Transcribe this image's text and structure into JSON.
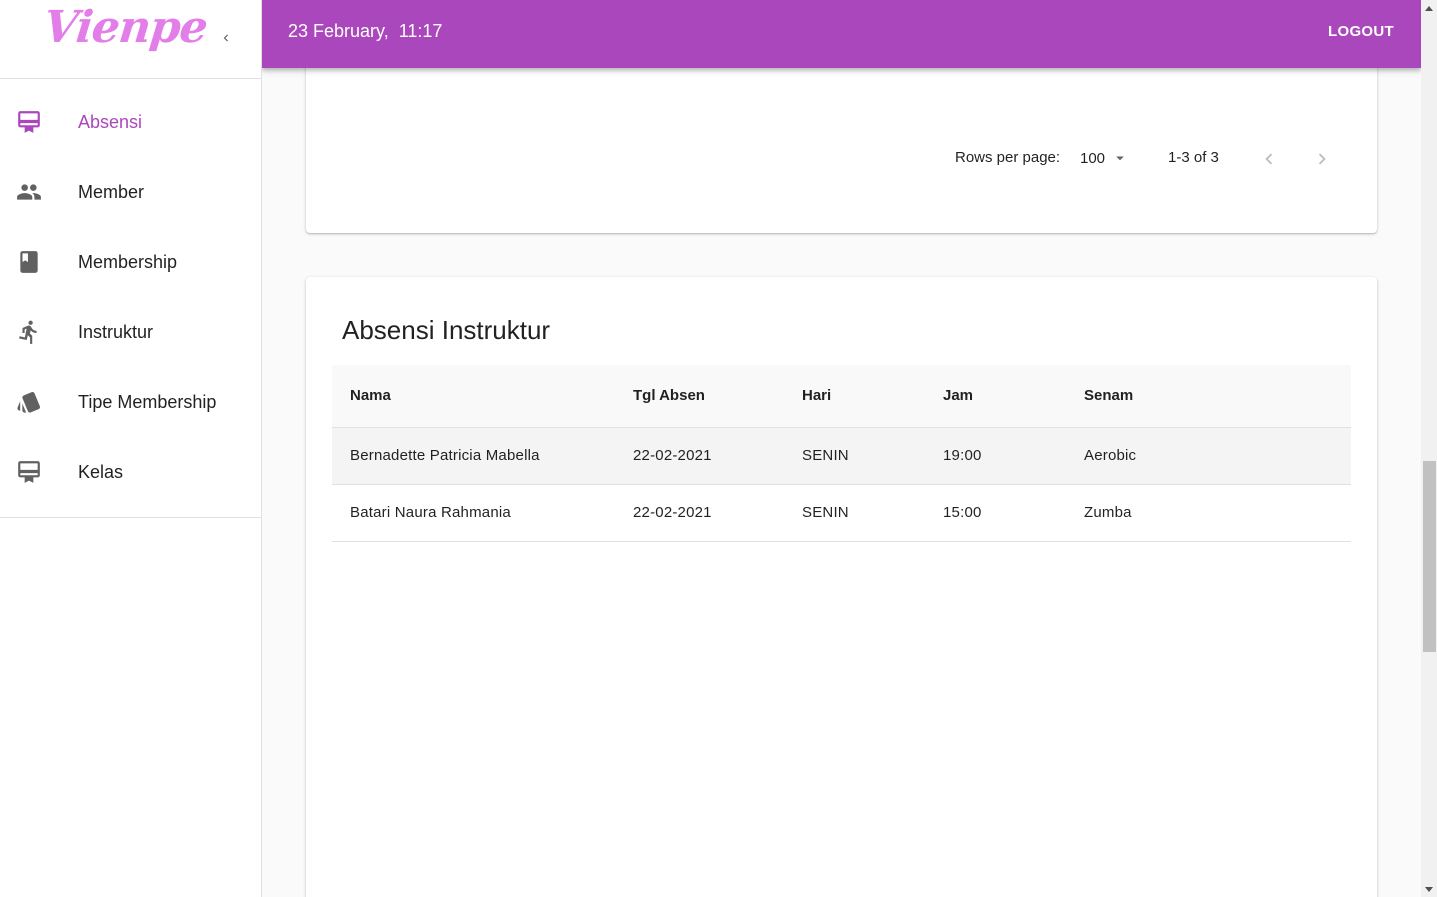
{
  "app": {
    "logo_text": "Vienpe",
    "brand_color": "#ab47bc",
    "logo_color": "#e37ee9"
  },
  "sidebar": {
    "collapse_icon": "chevron-left-icon",
    "items": [
      {
        "label": "Absensi",
        "icon": "card-membership-icon",
        "active": true
      },
      {
        "label": "Member",
        "icon": "people-icon",
        "active": false
      },
      {
        "label": "Membership",
        "icon": "book-icon",
        "active": false
      },
      {
        "label": "Instruktur",
        "icon": "directions-run-icon",
        "active": false
      },
      {
        "label": "Tipe Membership",
        "icon": "style-cards-icon",
        "active": false
      },
      {
        "label": "Kelas",
        "icon": "card-membership-icon",
        "active": false
      }
    ]
  },
  "topbar": {
    "datetime": "23 February,  11:17",
    "logout_label": "LOGOUT"
  },
  "top_card": {
    "pagination": {
      "rows_per_page_label": "Rows per page:",
      "rows_per_page_value": "100",
      "range_text": "1-3 of 3"
    }
  },
  "instructor_card": {
    "title": "Absensi Instruktur",
    "columns": [
      "Nama",
      "Tgl Absen",
      "Hari",
      "Jam",
      "Senam"
    ],
    "rows": [
      [
        "Bernadette Patricia Mabella",
        "22-02-2021",
        "SENIN",
        "19:00",
        "Aerobic"
      ],
      [
        "Batari Naura Rahmania",
        "22-02-2021",
        "SENIN",
        "15:00",
        "Zumba"
      ]
    ]
  }
}
